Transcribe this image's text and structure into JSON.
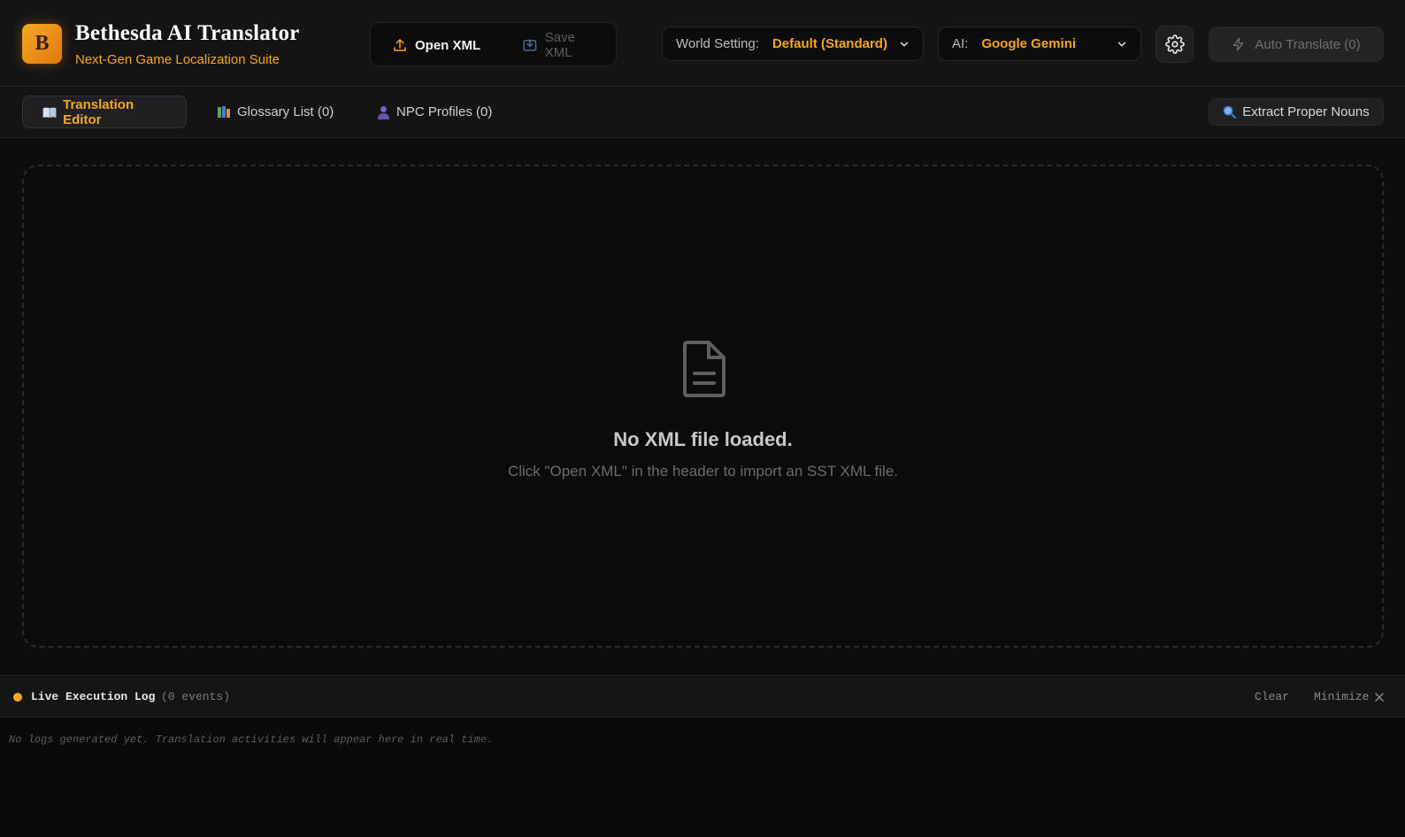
{
  "header": {
    "logo_letter": "B",
    "title": "Bethesda AI Translator",
    "subtitle": "Next-Gen Game Localization Suite",
    "open_xml": "Open XML",
    "save_xml": "Save XML",
    "world_setting": {
      "label": "World Setting:",
      "value": "Default (Standard)"
    },
    "ai": {
      "label": "AI:",
      "value": "Google Gemini"
    },
    "auto_translate": "Auto Translate (0)"
  },
  "tabs": [
    {
      "label": "Translation Editor",
      "icon": "book-icon",
      "active": true
    },
    {
      "label": "Glossary List (0)",
      "icon": "books-icon",
      "active": false
    },
    {
      "label": "NPC Profiles (0)",
      "icon": "person-icon",
      "active": false
    }
  ],
  "extract": {
    "label": "Extract Proper Nouns",
    "icon": "magnifier-icon"
  },
  "empty_state": {
    "icon": "document-icon",
    "title": "No XML file loaded.",
    "subtitle": "Click \"Open XML\" in the header to import an SST XML file."
  },
  "log": {
    "title": "Live Execution Log",
    "count": "(0 events)",
    "clear": "Clear",
    "minimize": "Minimize",
    "empty_message": "No logs generated yet. Translation activities will appear here in real time."
  },
  "colors": {
    "accent": "#f5a623",
    "background": "#0d0d0e",
    "panel": "#141415"
  }
}
